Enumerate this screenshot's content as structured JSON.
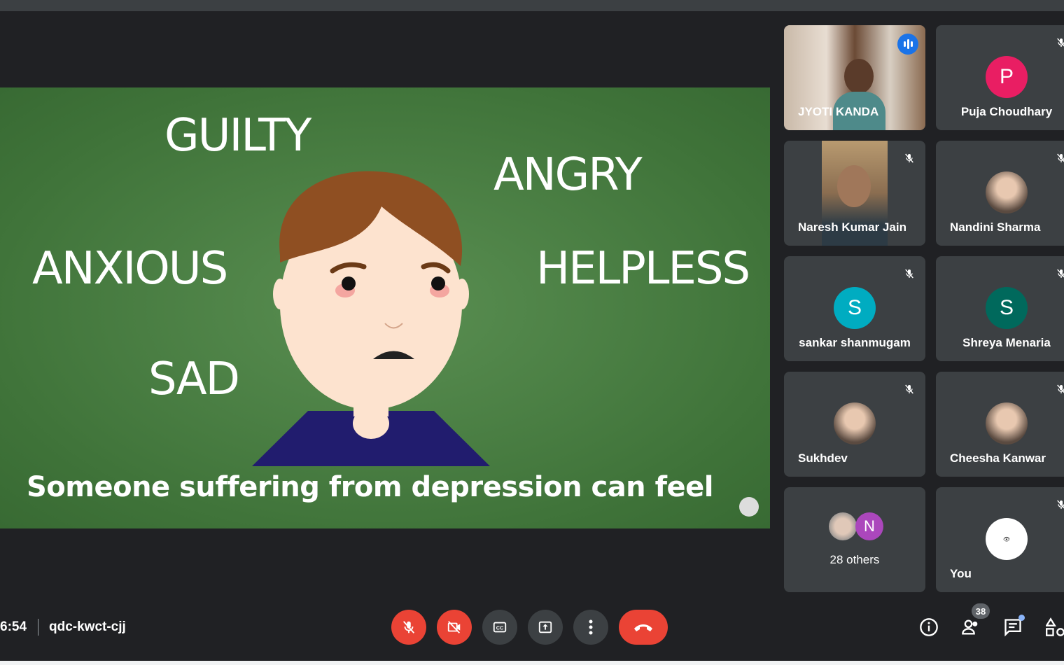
{
  "slide": {
    "words": [
      "GUILTY",
      "ANGRY",
      "ANXIOUS",
      "HELPLESS",
      "SAD"
    ],
    "caption": "Someone suffering from depression can feel"
  },
  "participants": [
    {
      "name": "JYOTI KANDA",
      "type": "video",
      "speaking": true
    },
    {
      "name": "Puja Choudhary",
      "initial": "P",
      "color": "#e91e63",
      "muted": true
    },
    {
      "name": "Naresh Kumar Jain",
      "type": "video",
      "muted": true
    },
    {
      "name": "Nandini Sharma",
      "type": "photo",
      "muted": true
    },
    {
      "name": "sankar shanmugam",
      "initial": "S",
      "color": "#00acc1",
      "muted": true
    },
    {
      "name": "Shreya Menaria",
      "initial": "S",
      "color": "#00695c",
      "muted": true
    },
    {
      "name": "Sukhdev",
      "type": "photo",
      "muted": true
    },
    {
      "name": "Cheesha Kanwar",
      "type": "photo",
      "muted": true
    },
    {
      "name": "28 others",
      "initial": "N",
      "color": "#ab47bc"
    },
    {
      "name": "You",
      "type": "logo",
      "muted": true
    }
  ],
  "footer": {
    "time": "6:54",
    "meeting_code": "qdc-kwct-cjj",
    "people_count": "38"
  },
  "controls": [
    "mic-off-icon",
    "camera-off-icon",
    "captions-icon",
    "present-icon",
    "more-icon",
    "end-call-icon"
  ],
  "colors": {
    "danger": "#ea4335",
    "tile": "#3c4043",
    "background": "#202124",
    "slide": "#4a7f43"
  }
}
